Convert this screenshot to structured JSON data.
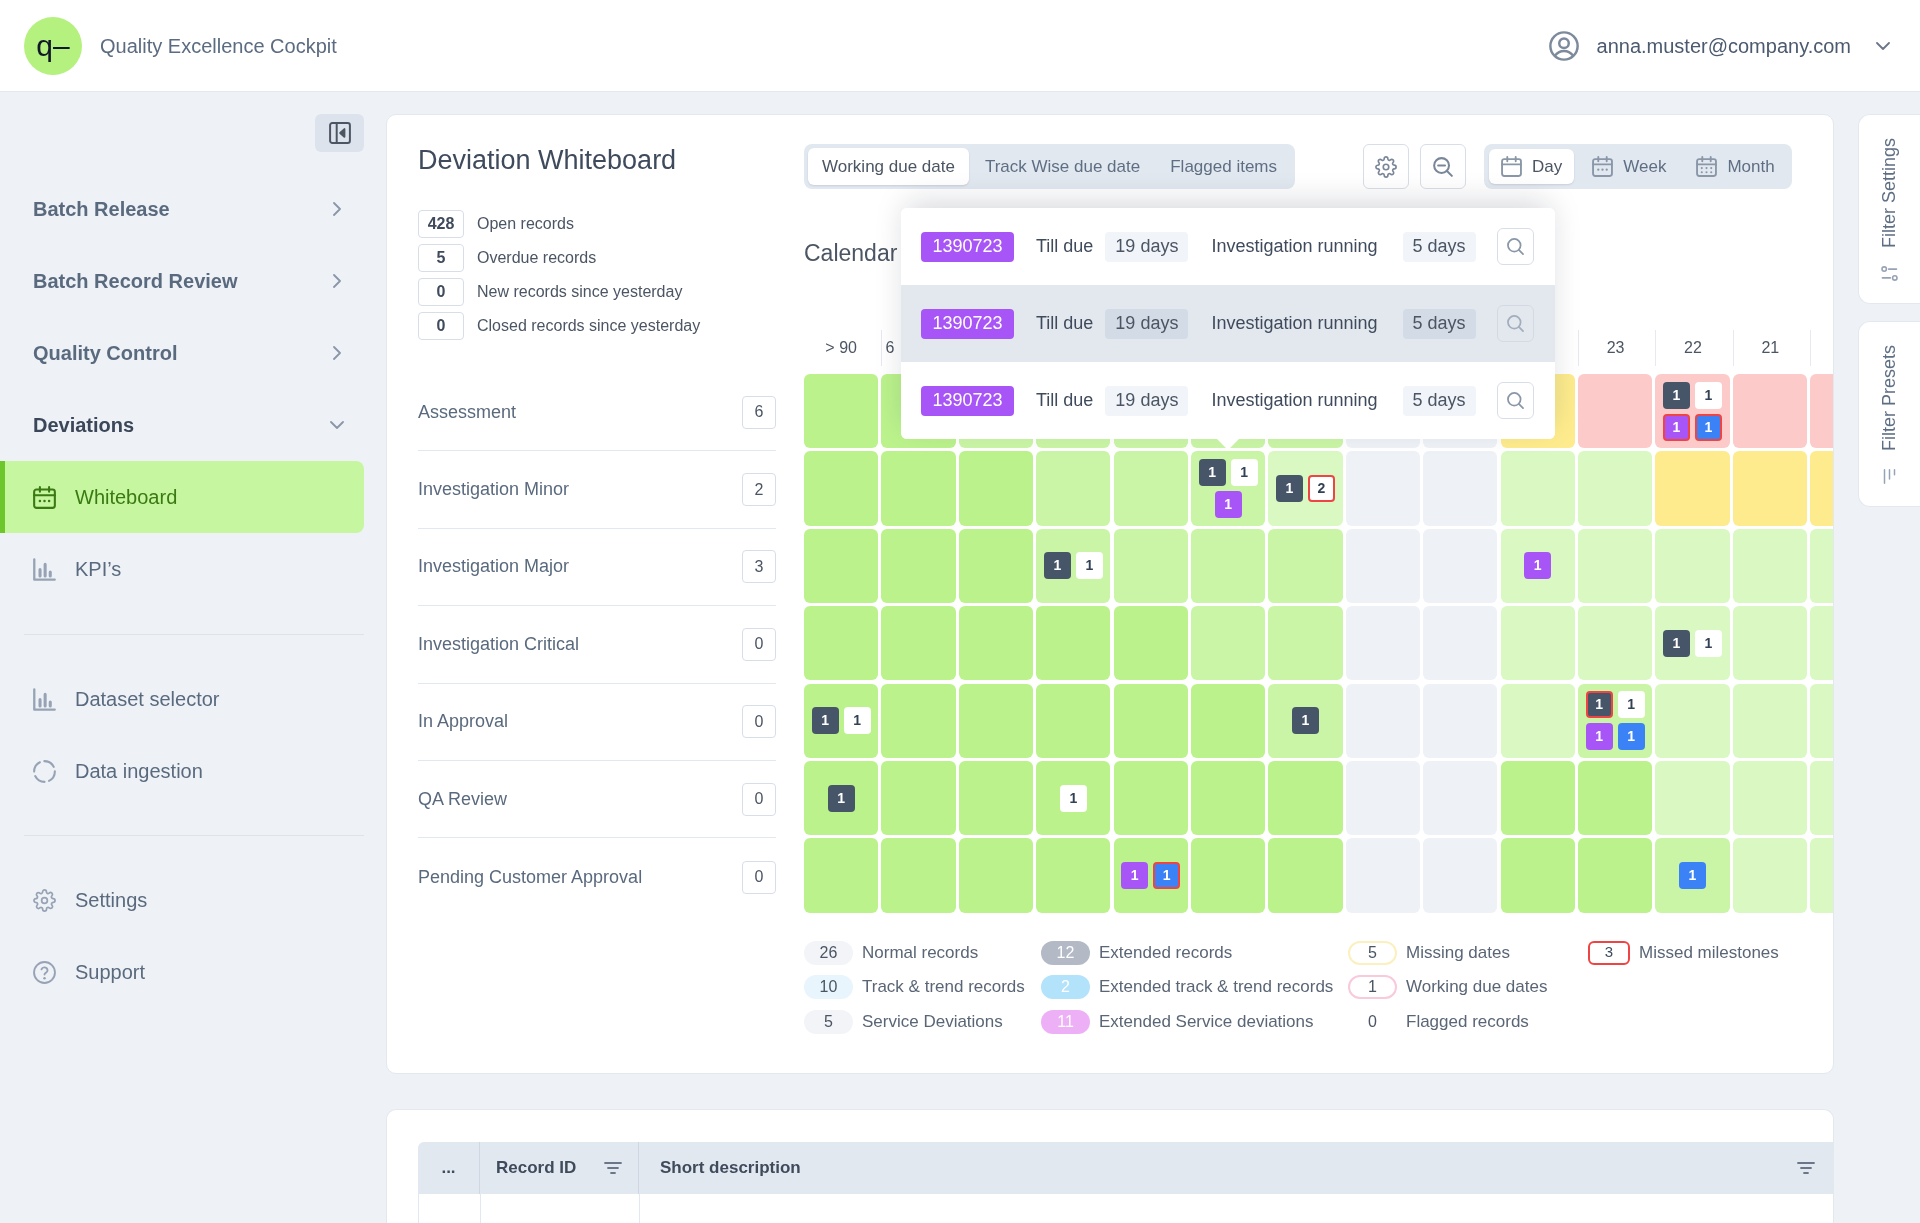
{
  "header": {
    "logo": "q–",
    "app_title": "Quality Excellence Cockpit",
    "user_email": "anna.muster@company.com"
  },
  "sidebar": {
    "menu": [
      {
        "label": "Batch Release",
        "expanded": false
      },
      {
        "label": "Batch Record Review",
        "expanded": false
      },
      {
        "label": "Quality Control",
        "expanded": false
      },
      {
        "label": "Deviations",
        "expanded": true,
        "children": [
          {
            "label": "Whiteboard",
            "selected": true
          },
          {
            "label": "KPI’s",
            "selected": false
          }
        ]
      }
    ],
    "tools": [
      {
        "label": "Dataset selector",
        "selected": false
      },
      {
        "label": "Data ingestion",
        "selected": false
      }
    ],
    "footer": [
      {
        "label": "Settings",
        "selected": false
      },
      {
        "label": "Support",
        "selected": false
      }
    ]
  },
  "whiteboard": {
    "title": "Deviation Whiteboard",
    "stats": [
      {
        "value": "428",
        "label": "Open records"
      },
      {
        "value": "5",
        "label": "Overdue records"
      },
      {
        "value": "0",
        "label": "New records since yesterday"
      },
      {
        "value": "0",
        "label": "Closed records since yesterday"
      }
    ],
    "date_modes": [
      {
        "label": "Working due date",
        "selected": true
      },
      {
        "label": "Track Wise due date",
        "selected": false
      },
      {
        "label": "Flagged items",
        "selected": false
      }
    ],
    "views": [
      {
        "label": "Day",
        "selected": true
      },
      {
        "label": "Week",
        "selected": false
      },
      {
        "label": "Month",
        "selected": false
      }
    ],
    "calendar_title": "Calendar",
    "columns": [
      {
        "kind": "label",
        "label": "> 90"
      },
      {
        "kind": "cut",
        "label": "6"
      },
      {
        "kind": "covered"
      },
      {
        "kind": "covered"
      },
      {
        "kind": "covered"
      },
      {
        "kind": "covered"
      },
      {
        "kind": "covered"
      },
      {
        "kind": "covered"
      },
      {
        "kind": "covered"
      },
      {
        "kind": "covered"
      },
      {
        "kind": "label",
        "label": "23"
      },
      {
        "kind": "label",
        "label": "22"
      },
      {
        "kind": "label",
        "label": "21"
      },
      {
        "kind": "covered"
      }
    ],
    "stages": [
      {
        "label": "Assessment",
        "count": "6"
      },
      {
        "label": "Investigation Minor",
        "count": "2"
      },
      {
        "label": "Investigation Major",
        "count": "3"
      },
      {
        "label": "Investigation Critical",
        "count": "0"
      },
      {
        "label": "In Approval",
        "count": "0"
      },
      {
        "label": "QA Review",
        "count": "0"
      },
      {
        "label": "Pending Customer Approval",
        "count": "0"
      }
    ],
    "rows": [
      {
        "cells": [
          {
            "color": "#bbf28c"
          },
          {
            "color": "#bbf28c"
          },
          {
            "color": "#caf5a6"
          },
          {
            "color": "#caf5a6"
          },
          {
            "color": "#caf5a6"
          },
          {
            "color": "#caf5a6"
          },
          {
            "color": "#caf5a6"
          },
          {
            "color": "#eef1f6"
          },
          {
            "color": "#eef1f6"
          },
          {
            "color": "#fdeb8d"
          },
          {
            "color": "#fdcaca"
          },
          {
            "color": "#fdcaca",
            "badges": [
              {
                "count": "1",
                "color": "#475569",
                "missed": false
              },
              {
                "count": "1",
                "color": "#ffffff",
                "missed": false
              },
              {
                "count": "1",
                "color": "#a855f7",
                "missed": true
              },
              {
                "count": "1",
                "color": "#3b82f6",
                "missed": true
              }
            ]
          },
          {
            "color": "#fdcaca"
          },
          {
            "color": "#fdcaca"
          }
        ]
      },
      {
        "cells": [
          {
            "color": "#bbf28c"
          },
          {
            "color": "#bbf28c"
          },
          {
            "color": "#bbf28c"
          },
          {
            "color": "#caf5a6"
          },
          {
            "color": "#caf5a6"
          },
          {
            "color": "#caf5a6",
            "badges": [
              {
                "count": "1",
                "color": "#475569",
                "missed": false
              },
              {
                "count": "1",
                "color": "#ffffff",
                "missed": false
              },
              {
                "count": "1",
                "color": "#a855f7",
                "missed": false
              }
            ]
          },
          {
            "color": "#daf8c2",
            "badges": [
              {
                "count": "1",
                "color": "#475569",
                "missed": false
              },
              {
                "count": "2",
                "color": "#ffffff",
                "missed": true
              }
            ]
          },
          {
            "color": "#eef1f6"
          },
          {
            "color": "#eef1f6"
          },
          {
            "color": "#daf8c2"
          },
          {
            "color": "#daf8c2"
          },
          {
            "color": "#fdeb8d"
          },
          {
            "color": "#fdeb8d"
          },
          {
            "color": "#fdeb8d"
          }
        ]
      },
      {
        "cells": [
          {
            "color": "#bbf28c"
          },
          {
            "color": "#bbf28c"
          },
          {
            "color": "#bbf28c"
          },
          {
            "color": "#caf5a6",
            "badges": [
              {
                "count": "1",
                "color": "#475569",
                "missed": false
              },
              {
                "count": "1",
                "color": "#ffffff",
                "missed": false
              }
            ]
          },
          {
            "color": "#caf5a6"
          },
          {
            "color": "#caf5a6"
          },
          {
            "color": "#caf5a6"
          },
          {
            "color": "#eef1f6"
          },
          {
            "color": "#eef1f6"
          },
          {
            "color": "#daf8c2",
            "badges": [
              {
                "count": "1",
                "color": "#a855f7",
                "missed": false
              }
            ]
          },
          {
            "color": "#daf8c2"
          },
          {
            "color": "#daf8c2"
          },
          {
            "color": "#daf8c2"
          },
          {
            "color": "#daf8c2"
          }
        ]
      },
      {
        "cells": [
          {
            "color": "#bbf28c"
          },
          {
            "color": "#bbf28c"
          },
          {
            "color": "#bbf28c"
          },
          {
            "color": "#bbf28c"
          },
          {
            "color": "#bbf28c"
          },
          {
            "color": "#caf5a6"
          },
          {
            "color": "#caf5a6"
          },
          {
            "color": "#eef1f6"
          },
          {
            "color": "#eef1f6"
          },
          {
            "color": "#daf8c2"
          },
          {
            "color": "#daf8c2"
          },
          {
            "color": "#daf8c2",
            "badges": [
              {
                "count": "1",
                "color": "#475569",
                "missed": false
              },
              {
                "count": "1",
                "color": "#ffffff",
                "missed": false
              }
            ]
          },
          {
            "color": "#daf8c2"
          },
          {
            "color": "#daf8c2"
          }
        ]
      },
      {
        "cells": [
          {
            "color": "#bbf28c",
            "badges": [
              {
                "count": "1",
                "color": "#475569",
                "missed": false
              },
              {
                "count": "1",
                "color": "#ffffff",
                "missed": false
              }
            ]
          },
          {
            "color": "#bbf28c"
          },
          {
            "color": "#bbf28c"
          },
          {
            "color": "#bbf28c"
          },
          {
            "color": "#bbf28c"
          },
          {
            "color": "#bbf28c"
          },
          {
            "color": "#caf5a6",
            "badges": [
              {
                "count": "1",
                "color": "#475569",
                "missed": false
              }
            ]
          },
          {
            "color": "#eef1f6"
          },
          {
            "color": "#eef1f6"
          },
          {
            "color": "#daf8c2"
          },
          {
            "color": "#caf5a6",
            "badges": [
              {
                "count": "1",
                "color": "#475569",
                "missed": true
              },
              {
                "count": "1",
                "color": "#ffffff",
                "missed": false
              },
              {
                "count": "1",
                "color": "#a855f7",
                "missed": false
              },
              {
                "count": "1",
                "color": "#3b82f6",
                "missed": false
              }
            ]
          },
          {
            "color": "#daf8c2"
          },
          {
            "color": "#daf8c2"
          },
          {
            "color": "#daf8c2"
          }
        ]
      },
      {
        "cells": [
          {
            "color": "#bbf28c",
            "badges": [
              {
                "count": "1",
                "color": "#475569",
                "missed": false
              }
            ]
          },
          {
            "color": "#bbf28c"
          },
          {
            "color": "#bbf28c"
          },
          {
            "color": "#bbf28c",
            "badges": [
              {
                "count": "1",
                "color": "#ffffff",
                "missed": false
              }
            ]
          },
          {
            "color": "#bbf28c"
          },
          {
            "color": "#bbf28c"
          },
          {
            "color": "#bbf28c"
          },
          {
            "color": "#eef1f6"
          },
          {
            "color": "#eef1f6"
          },
          {
            "color": "#bbf28c"
          },
          {
            "color": "#bbf28c"
          },
          {
            "color": "#daf8c2"
          },
          {
            "color": "#daf8c2"
          },
          {
            "color": "#daf8c2"
          }
        ]
      },
      {
        "cells": [
          {
            "color": "#bbf28c"
          },
          {
            "color": "#bbf28c"
          },
          {
            "color": "#bbf28c"
          },
          {
            "color": "#bbf28c"
          },
          {
            "color": "#bbf28c",
            "badges": [
              {
                "count": "1",
                "color": "#a855f7",
                "missed": false
              },
              {
                "count": "1",
                "color": "#3b82f6",
                "missed": true
              }
            ]
          },
          {
            "color": "#bbf28c"
          },
          {
            "color": "#bbf28c"
          },
          {
            "color": "#eef1f6"
          },
          {
            "color": "#eef1f6"
          },
          {
            "color": "#bbf28c"
          },
          {
            "color": "#bbf28c"
          },
          {
            "color": "#caf5a6",
            "badges": [
              {
                "count": "1",
                "color": "#3b82f6",
                "missed": false
              }
            ]
          },
          {
            "color": "#daf8c2"
          },
          {
            "color": "#daf8c2"
          }
        ]
      }
    ],
    "popover": {
      "rows": [
        {
          "record_id": "1390723",
          "due_label": "Till due",
          "due": "19 days",
          "status": "Investigation running",
          "duration": "5 days",
          "highlighted": false
        },
        {
          "record_id": "1390723",
          "due_label": "Till due",
          "due": "19 days",
          "status": "Investigation running",
          "duration": "5 days",
          "highlighted": true
        },
        {
          "record_id": "1390723",
          "due_label": "Till due",
          "due": "19 days",
          "status": "Investigation running",
          "duration": "5 days",
          "highlighted": false
        }
      ]
    },
    "legend": [
      {
        "items": [
          {
            "kind": "tint",
            "count": "26",
            "label": "Normal records",
            "color": "#f2f4f7"
          },
          {
            "kind": "tint",
            "count": "10",
            "label": "Track & trend records",
            "color": "#e8f5fd"
          },
          {
            "kind": "tint",
            "count": "5",
            "label": "Service Deviations",
            "color": "#f2f4f7"
          }
        ]
      },
      {
        "items": [
          {
            "kind": "solid",
            "count": "12",
            "label": "Extended records",
            "color": "#b3bac6"
          },
          {
            "kind": "solid",
            "count": "2",
            "label": "Extended track & trend records",
            "color": "#b3e2fb"
          },
          {
            "kind": "solid",
            "count": "11",
            "label": "Extended Service deviations",
            "color": "#edb0f6"
          }
        ]
      },
      {
        "items": [
          {
            "kind": "ring",
            "count": "5",
            "label": "Missing dates",
            "color": "#fbf0bf"
          },
          {
            "kind": "ring",
            "count": "1",
            "label": "Working due dates",
            "color": "#f9c9dc"
          },
          {
            "kind": "plain",
            "count": "0",
            "label": "Flagged records"
          }
        ]
      },
      {
        "items": [
          {
            "kind": "frame",
            "count": "3",
            "label": "Missed milestones",
            "color": "#ef4444"
          }
        ]
      }
    ]
  },
  "side_tabs": [
    {
      "label": "Filter Settings"
    },
    {
      "label": "Filter Presets"
    }
  ],
  "table": {
    "columns": [
      {
        "label": "...",
        "filter": false
      },
      {
        "label": "Record ID",
        "filter": true
      },
      {
        "label": "Short description",
        "filter": true
      }
    ]
  }
}
